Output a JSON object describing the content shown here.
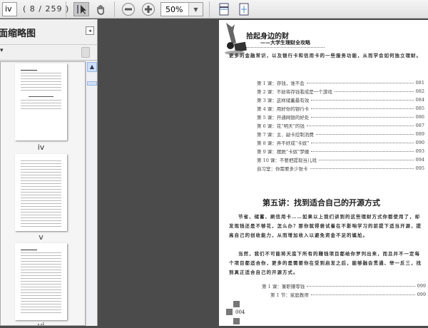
{
  "toolbar": {
    "page_value": "iv",
    "page_count": "( 8 / 259 )",
    "zoom_value": "50%"
  },
  "panel": {
    "title": "面缩略图",
    "collapse": "◂",
    "options": "▾",
    "thumbnails": [
      {
        "label": "iv"
      },
      {
        "label": "v"
      },
      {
        "label": "vi"
      }
    ]
  },
  "page": {
    "book_title": "拾起身边的财",
    "book_subtitle": "——大学生理财全攻略",
    "intro": "更多的金融常识，以及银行卡和信用卡的一些服务功能，从而学会如何独立理财。",
    "toc1": [
      {
        "label": "第 1 课：存钱，谁不会",
        "page": "081"
      },
      {
        "label": "第 2 课：不妨将存钱看成是一个游戏",
        "page": "082"
      },
      {
        "label": "第 3 课：这样储蓄最有效",
        "page": "084"
      },
      {
        "label": "第 4 课：用好你的银行卡",
        "page": "085"
      },
      {
        "label": "第 5 课：开通网银的好处",
        "page": "086"
      },
      {
        "label": "第 6 课：花“明天”的钱",
        "page": "087"
      },
      {
        "label": "第 7 课：主、副卡控制消费",
        "page": "089"
      },
      {
        "label": "第 8 课：弄不好成“卡奴”",
        "page": "090"
      },
      {
        "label": "第 9 课：摆脱“卡奴”梦魇",
        "page": "093"
      },
      {
        "label": "第 10 课：不要把提现当儿戏",
        "page": "094"
      },
      {
        "label": "自习室：你需要多少张卡",
        "page": "095"
      }
    ],
    "heading": "第五讲：找到适合自己的开源方式",
    "para1": "节省、储蓄、刷信用卡……如果以上我们讲到的这些理财方式你都使用了，却发现钱还是不够花，怎么办？那你就得尝试着在不影响学习的前提下适当开源，提高自己的创收能力，从而增加收入以避免资金不足的尴尬。",
    "para2": "当然，我们不可能将天底下所有的赚钱项目都给你罗列出来，而且并不一定每个项目都适合你，更多的是需要你在受到启发之后，能够融会贯通、举一反三，找到真正适合自己的开源方式。",
    "toc2": [
      {
        "label": "第 1 课：兼职赚零钱",
        "page": "099"
      },
      {
        "label": "第 1 节：家庭教师",
        "page": "099"
      }
    ],
    "page_number": "004"
  }
}
